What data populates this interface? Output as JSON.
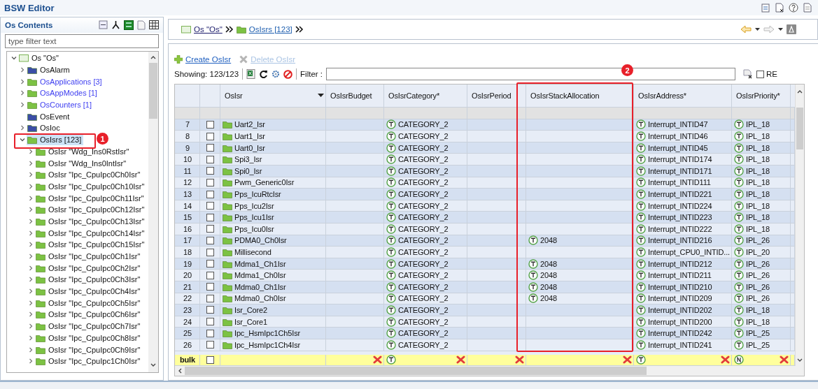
{
  "window": {
    "title": "BSW Editor"
  },
  "sidebar": {
    "title": "Os Contents",
    "filter": {
      "placeholder": "type filter text"
    },
    "tree": [
      {
        "label": "Os \"Os\"",
        "kind": "module",
        "expanded": true,
        "selected": false,
        "children": [
          {
            "label": "OsAlarm",
            "kind": "folder",
            "color": "#3b4ea6",
            "emphasized": false,
            "expanded": false,
            "selected": false
          },
          {
            "label": "OsApplications [3]",
            "kind": "folder",
            "color": "#7cc243",
            "emphasized": true,
            "expanded": false,
            "selected": false
          },
          {
            "label": "OsAppModes [1]",
            "kind": "folder",
            "color": "#7cc243",
            "emphasized": true,
            "expanded": false,
            "selected": false
          },
          {
            "label": "OsCounters [1]",
            "kind": "folder",
            "color": "#7cc243",
            "emphasized": true,
            "expanded": false,
            "selected": false
          },
          {
            "label": "OsEvent",
            "kind": "folder",
            "color": "#3b4ea6",
            "emphasized": false,
            "selected": false
          },
          {
            "label": "OsIoc",
            "kind": "folder",
            "color": "#3b4ea6",
            "emphasized": false,
            "expanded": false,
            "selected": false
          },
          {
            "label": "OsIsrs [123]",
            "kind": "folder",
            "color": "#7cc243",
            "emphasized": false,
            "expanded": true,
            "selected": true,
            "children": [
              {
                "label": "OsIsr \"Wdg_Ins0RstIsr\"",
                "kind": "folder",
                "color": "#7cc243",
                "emphasized": false,
                "expanded": false,
                "selected": false
              },
              {
                "label": "OsIsr \"Wdg_Ins0IntIsr\"",
                "kind": "folder",
                "color": "#7cc243",
                "emphasized": false,
                "expanded": false,
                "selected": false
              },
              {
                "label": "OsIsr \"Ipc_CpuIpc0Ch0Isr\"",
                "kind": "folder",
                "color": "#7cc243",
                "emphasized": false,
                "expanded": false,
                "selected": false
              },
              {
                "label": "OsIsr \"Ipc_CpuIpc0Ch10Isr\"",
                "kind": "folder",
                "color": "#7cc243",
                "emphasized": false,
                "expanded": false,
                "selected": false
              },
              {
                "label": "OsIsr \"Ipc_CpuIpc0Ch11Isr\"",
                "kind": "folder",
                "color": "#7cc243",
                "emphasized": false,
                "expanded": false,
                "selected": false
              },
              {
                "label": "OsIsr \"Ipc_CpuIpc0Ch12Isr\"",
                "kind": "folder",
                "color": "#7cc243",
                "emphasized": false,
                "expanded": false,
                "selected": false
              },
              {
                "label": "OsIsr \"Ipc_CpuIpc0Ch13Isr\"",
                "kind": "folder",
                "color": "#7cc243",
                "emphasized": false,
                "expanded": false,
                "selected": false
              },
              {
                "label": "OsIsr \"Ipc_CpuIpc0Ch14Isr\"",
                "kind": "folder",
                "color": "#7cc243",
                "emphasized": false,
                "expanded": false,
                "selected": false
              },
              {
                "label": "OsIsr \"Ipc_CpuIpc0Ch15Isr\"",
                "kind": "folder",
                "color": "#7cc243",
                "emphasized": false,
                "expanded": false,
                "selected": false
              },
              {
                "label": "OsIsr \"Ipc_CpuIpc0Ch1Isr\"",
                "kind": "folder",
                "color": "#7cc243",
                "emphasized": false,
                "expanded": false,
                "selected": false
              },
              {
                "label": "OsIsr \"Ipc_CpuIpc0Ch2Isr\"",
                "kind": "folder",
                "color": "#7cc243",
                "emphasized": false,
                "expanded": false,
                "selected": false
              },
              {
                "label": "OsIsr \"Ipc_CpuIpc0Ch3Isr\"",
                "kind": "folder",
                "color": "#7cc243",
                "emphasized": false,
                "expanded": false,
                "selected": false
              },
              {
                "label": "OsIsr \"Ipc_CpuIpc0Ch4Isr\"",
                "kind": "folder",
                "color": "#7cc243",
                "emphasized": false,
                "expanded": false,
                "selected": false
              },
              {
                "label": "OsIsr \"Ipc_CpuIpc0Ch5Isr\"",
                "kind": "folder",
                "color": "#7cc243",
                "emphasized": false,
                "expanded": false,
                "selected": false
              },
              {
                "label": "OsIsr \"Ipc_CpuIpc0Ch6Isr\"",
                "kind": "folder",
                "color": "#7cc243",
                "emphasized": false,
                "expanded": false,
                "selected": false
              },
              {
                "label": "OsIsr \"Ipc_CpuIpc0Ch7Isr\"",
                "kind": "folder",
                "color": "#7cc243",
                "emphasized": false,
                "expanded": false,
                "selected": false
              },
              {
                "label": "OsIsr \"Ipc_CpuIpc0Ch8Isr\"",
                "kind": "folder",
                "color": "#7cc243",
                "emphasized": false,
                "expanded": false,
                "selected": false
              },
              {
                "label": "OsIsr \"Ipc_CpuIpc0Ch9Isr\"",
                "kind": "folder",
                "color": "#7cc243",
                "emphasized": false,
                "expanded": false,
                "selected": false
              },
              {
                "label": "OsIsr \"Ipc_CpuIpc1Ch0Isr\"",
                "kind": "folder",
                "color": "#7cc243",
                "emphasized": false,
                "expanded": false,
                "selected": false
              }
            ]
          }
        ]
      }
    ]
  },
  "editor": {
    "breadcrumb": [
      {
        "label": "Os \"Os\"",
        "kind": "module"
      },
      {
        "label": "OsIsrs [123]",
        "kind": "folder"
      }
    ],
    "back": {
      "disabled": false
    },
    "forward": {
      "disabled": true
    },
    "actions": [
      {
        "label": "Create OsIsr",
        "kind": "create",
        "disabled": false
      },
      {
        "label": "Delete OsIsr",
        "kind": "delete",
        "disabled": true
      }
    ],
    "showing": "Showing: 123/123",
    "filter": {
      "label": "Filter :"
    },
    "regex": {
      "label": "RE",
      "checked": false
    },
    "table": {
      "columns": [
        {
          "label": "OsIsr",
          "dropdown": true
        },
        {
          "label": "OsIsrBudget",
          "dropdown": false
        },
        {
          "label": "OsIsrCategory*",
          "dropdown": false
        },
        {
          "label": "OsIsrPeriod",
          "dropdown": false
        },
        {
          "label": "OsIsrStackAllocation",
          "dropdown": false
        },
        {
          "label": "OsIsrAddress*",
          "dropdown": false
        },
        {
          "label": "OsIsrPriority*",
          "dropdown": false
        }
      ],
      "rows": [
        {
          "number": "7",
          "checked": false,
          "cells": [
            "Uart2_Isr",
            null,
            "CATEGORY_2",
            null,
            null,
            "Interrupt_INTID47",
            "IPL_18"
          ]
        },
        {
          "number": "8",
          "checked": false,
          "cells": [
            "Uart1_Isr",
            null,
            "CATEGORY_2",
            null,
            null,
            "Interrupt_INTID46",
            "IPL_18"
          ]
        },
        {
          "number": "9",
          "checked": false,
          "cells": [
            "Uart0_Isr",
            null,
            "CATEGORY_2",
            null,
            null,
            "Interrupt_INTID45",
            "IPL_18"
          ]
        },
        {
          "number": "10",
          "checked": false,
          "cells": [
            "Spi3_Isr",
            null,
            "CATEGORY_2",
            null,
            null,
            "Interrupt_INTID174",
            "IPL_18"
          ]
        },
        {
          "number": "11",
          "checked": false,
          "cells": [
            "Spi0_Isr",
            null,
            "CATEGORY_2",
            null,
            null,
            "Interrupt_INTID171",
            "IPL_18"
          ]
        },
        {
          "number": "12",
          "checked": false,
          "cells": [
            "Pwm_Generic0Isr",
            null,
            "CATEGORY_2",
            null,
            null,
            "Interrupt_INTID111",
            "IPL_18"
          ]
        },
        {
          "number": "13",
          "checked": false,
          "cells": [
            "Pps_IcuRtcIsr",
            null,
            "CATEGORY_2",
            null,
            null,
            "Interrupt_INTID221",
            "IPL_18"
          ]
        },
        {
          "number": "14",
          "checked": false,
          "cells": [
            "Pps_Icu2Isr",
            null,
            "CATEGORY_2",
            null,
            null,
            "Interrupt_INTID224",
            "IPL_18"
          ]
        },
        {
          "number": "15",
          "checked": false,
          "cells": [
            "Pps_Icu1Isr",
            null,
            "CATEGORY_2",
            null,
            null,
            "Interrupt_INTID223",
            "IPL_18"
          ]
        },
        {
          "number": "16",
          "checked": false,
          "cells": [
            "Pps_Icu0Isr",
            null,
            "CATEGORY_2",
            null,
            null,
            "Interrupt_INTID222",
            "IPL_18"
          ]
        },
        {
          "number": "17",
          "checked": false,
          "cells": [
            "PDMA0_Ch0Isr",
            null,
            "CATEGORY_2",
            null,
            "2048",
            "Interrupt_INTID216",
            "IPL_26"
          ]
        },
        {
          "number": "18",
          "checked": false,
          "cells": [
            "Millisecond",
            null,
            "CATEGORY_2",
            null,
            null,
            "Interrupt_CPU0_INTID...",
            "IPL_20"
          ]
        },
        {
          "number": "19",
          "checked": false,
          "cells": [
            "Mdma1_Ch1Isr",
            null,
            "CATEGORY_2",
            null,
            "2048",
            "Interrupt_INTID212",
            "IPL_26"
          ]
        },
        {
          "number": "20",
          "checked": false,
          "cells": [
            "Mdma1_Ch0Isr",
            null,
            "CATEGORY_2",
            null,
            "2048",
            "Interrupt_INTID211",
            "IPL_26"
          ]
        },
        {
          "number": "21",
          "checked": false,
          "cells": [
            "Mdma0_Ch1Isr",
            null,
            "CATEGORY_2",
            null,
            "2048",
            "Interrupt_INTID210",
            "IPL_26"
          ]
        },
        {
          "number": "22",
          "checked": false,
          "cells": [
            "Mdma0_Ch0Isr",
            null,
            "CATEGORY_2",
            null,
            "2048",
            "Interrupt_INTID209",
            "IPL_26"
          ]
        },
        {
          "number": "23",
          "checked": false,
          "cells": [
            "Isr_Core2",
            null,
            "CATEGORY_2",
            null,
            null,
            "Interrupt_INTID202",
            "IPL_18"
          ]
        },
        {
          "number": "24",
          "checked": false,
          "cells": [
            "Isr_Core1",
            null,
            "CATEGORY_2",
            null,
            null,
            "Interrupt_INTID200",
            "IPL_18"
          ]
        },
        {
          "number": "25",
          "checked": false,
          "cells": [
            "Ipc_HsmIpc1Ch5Isr",
            null,
            "CATEGORY_2",
            null,
            null,
            "Interrupt_INTID242",
            "IPL_25"
          ]
        },
        {
          "number": "26",
          "checked": false,
          "cells": [
            "Ipc_HsmIpc1Ch4Isr",
            null,
            "CATEGORY_2",
            null,
            null,
            "Interrupt_INTID241",
            "IPL_25"
          ]
        }
      ],
      "bulk": {
        "label": "bulk",
        "checked": false,
        "cells": [
          {
            "kind": "empty",
            "clearable": false
          },
          {
            "kind": "empty",
            "clearable": true
          },
          {
            "kind": "text",
            "clearable": true
          },
          {
            "kind": "empty",
            "clearable": true
          },
          {
            "kind": "empty",
            "clearable": true
          },
          {
            "kind": "text",
            "clearable": true
          },
          {
            "kind": "number",
            "clearable": true
          }
        ]
      }
    }
  },
  "annotations": [
    {
      "label": "1"
    },
    {
      "label": "2"
    }
  ]
}
